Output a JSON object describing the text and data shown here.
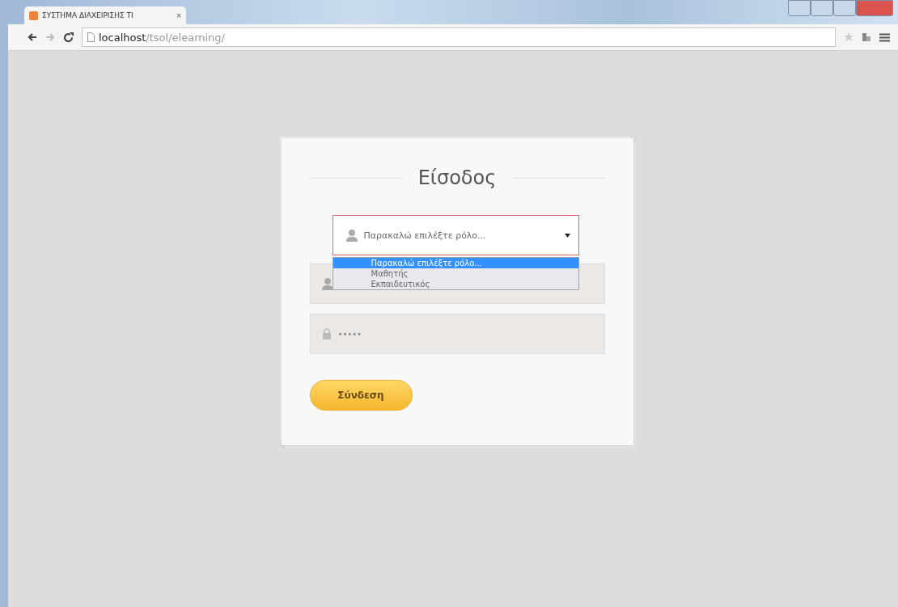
{
  "browser": {
    "tab": {
      "title": "ΣΥΣΤΗΜΑ ΔΙΑΧΕΙΡΙΣΗΣ ΤΙ",
      "close": "×"
    },
    "address": {
      "host": "localhost",
      "path": "/tsol/elearning/"
    }
  },
  "login": {
    "title": "Είσοδος",
    "role_select": {
      "value": "Παρακαλώ επιλέξτε ρόλο...",
      "expanded": true,
      "options": [
        {
          "label": "Παρακαλώ επιλέξτε ρόλο...",
          "selected": true
        },
        {
          "label": "Μαθητής",
          "selected": false
        },
        {
          "label": "Εκπαιδευτικός",
          "selected": false
        }
      ]
    },
    "password": {
      "value": "•••••"
    },
    "submit": "Σύνδεση"
  }
}
